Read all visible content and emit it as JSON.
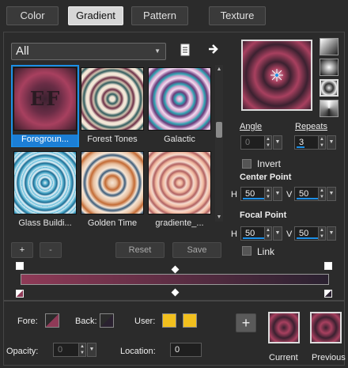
{
  "tabs": [
    {
      "label": "Color"
    },
    {
      "label": "Gradient"
    },
    {
      "label": "Pattern"
    },
    {
      "label": "Texture"
    }
  ],
  "category": {
    "value": "All"
  },
  "gradients": [
    {
      "caption": "Foregroun...",
      "logo": "EF"
    },
    {
      "caption": "Forest Tones"
    },
    {
      "caption": "Galactic"
    },
    {
      "caption": "Glass Buildi..."
    },
    {
      "caption": "Golden Time"
    },
    {
      "caption": "gradiente_..."
    }
  ],
  "list_buttons": {
    "add": "+",
    "remove": "-",
    "reset": "Reset",
    "save": "Save"
  },
  "angle": {
    "label": "Angle",
    "value": "0"
  },
  "repeats": {
    "label": "Repeats",
    "value": "3"
  },
  "invert": {
    "label": "Invert"
  },
  "center_point": {
    "label": "Center Point",
    "h_label": "H",
    "h": "50",
    "v_label": "V",
    "v": "50"
  },
  "focal_point": {
    "label": "Focal Point",
    "h_label": "H",
    "h": "50",
    "v_label": "V",
    "v": "50"
  },
  "link": {
    "label": "Link"
  },
  "bottom": {
    "fore_label": "Fore:",
    "back_label": "Back:",
    "user_label": "User:",
    "opacity_label": "Opacity:",
    "opacity_value": "0",
    "location_label": "Location:",
    "location_value": "0",
    "add_button": "+",
    "current_label": "Current",
    "previous_label": "Previous"
  },
  "colors": {
    "accent": "#1c8fe6",
    "gradient_start": "#8f3a57",
    "gradient_end": "#2a2130",
    "user_swatch": "#f2c01e"
  }
}
